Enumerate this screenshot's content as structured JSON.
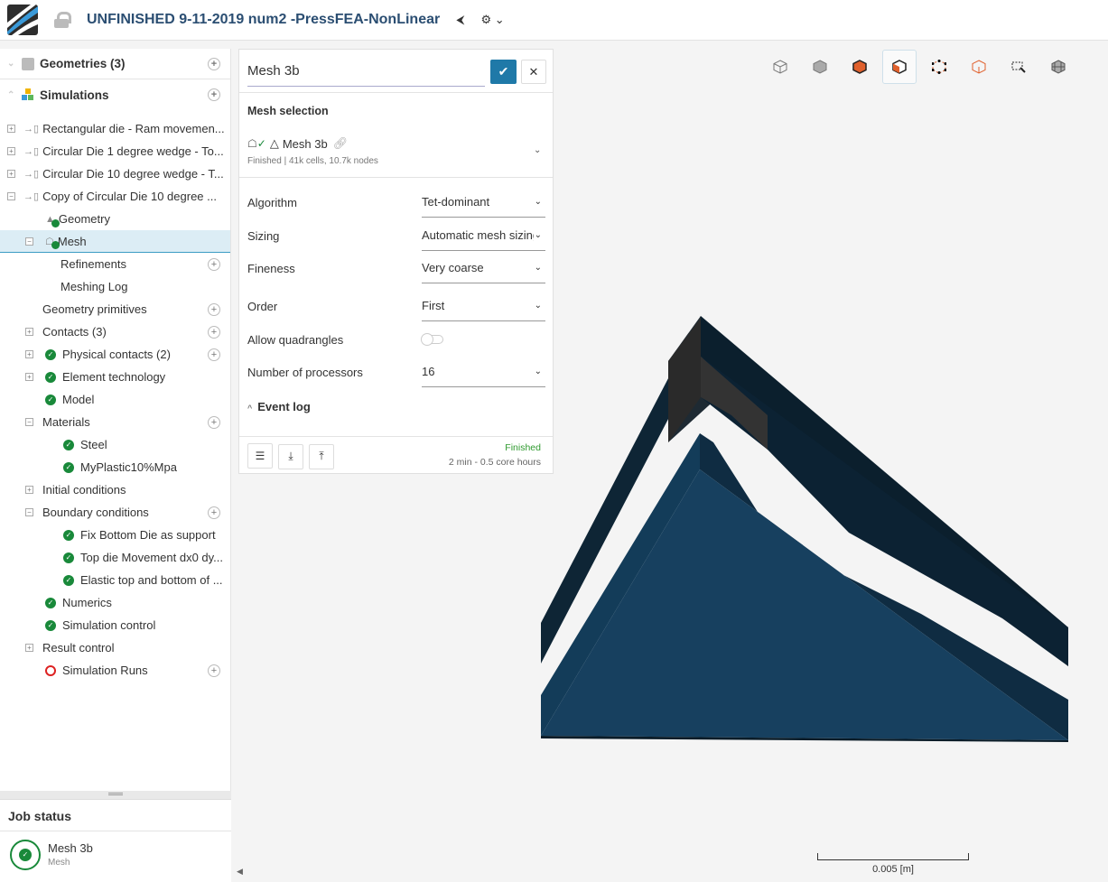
{
  "header": {
    "title": "UNFINISHED 9-11-2019 num2 -PressFEA-NonLinear",
    "share_icon": "share-icon",
    "settings_icon": "gear-icon"
  },
  "sidebar": {
    "geometries": "Geometries (3)",
    "simulations": "Simulations",
    "items": [
      {
        "label": "Rectangular die - Ram movemen...",
        "level": 0,
        "exp": "+",
        "icon": "sim",
        "plus": false
      },
      {
        "label": "Circular Die 1 degree wedge - To...",
        "level": 0,
        "exp": "+",
        "icon": "sim",
        "plus": false
      },
      {
        "label": "Circular Die 10 degree wedge - T...",
        "level": 0,
        "exp": "+",
        "icon": "sim",
        "plus": false
      },
      {
        "label": "Copy of Circular Die 10 degree ...",
        "level": 0,
        "exp": "-",
        "icon": "sim",
        "plus": false
      },
      {
        "label": "Geometry",
        "level": 1,
        "exp": "",
        "icon": "geo",
        "plus": false
      },
      {
        "label": "Mesh",
        "level": 1,
        "exp": "-",
        "icon": "mesh",
        "plus": false,
        "selected": true
      },
      {
        "label": "Refinements",
        "level": 2,
        "exp": "",
        "icon": "",
        "plus": true
      },
      {
        "label": "Meshing Log",
        "level": 2,
        "exp": "",
        "icon": "",
        "plus": false
      },
      {
        "label": "Geometry primitives",
        "level": 1,
        "exp": "",
        "icon": "",
        "plus": true,
        "tight": true
      },
      {
        "label": "Contacts (3)",
        "level": 1,
        "exp": "+",
        "icon": "",
        "plus": true,
        "tight": true
      },
      {
        "label": "Physical contacts (2)",
        "level": 1,
        "exp": "+",
        "icon": "check",
        "plus": true
      },
      {
        "label": "Element technology",
        "level": 1,
        "exp": "+",
        "icon": "check",
        "plus": false
      },
      {
        "label": "Model",
        "level": 1,
        "exp": "",
        "icon": "check",
        "plus": false
      },
      {
        "label": "Materials",
        "level": 1,
        "exp": "-",
        "icon": "",
        "plus": true,
        "tight": true
      },
      {
        "label": "Steel",
        "level": 2,
        "exp": "",
        "icon": "check",
        "plus": false
      },
      {
        "label": "MyPlastic10%Mpa",
        "level": 2,
        "exp": "",
        "icon": "check",
        "plus": false
      },
      {
        "label": "Initial conditions",
        "level": 1,
        "exp": "+",
        "icon": "",
        "plus": false,
        "tight": true
      },
      {
        "label": "Boundary conditions",
        "level": 1,
        "exp": "-",
        "icon": "",
        "plus": true,
        "tight": true
      },
      {
        "label": "Fix Bottom Die as support",
        "level": 2,
        "exp": "",
        "icon": "check",
        "plus": false
      },
      {
        "label": "Top die Movement dx0 dy...",
        "level": 2,
        "exp": "",
        "icon": "check",
        "plus": false
      },
      {
        "label": "Elastic top and bottom of ...",
        "level": 2,
        "exp": "",
        "icon": "check",
        "plus": false
      },
      {
        "label": "Numerics",
        "level": 1,
        "exp": "",
        "icon": "check",
        "plus": false
      },
      {
        "label": "Simulation control",
        "level": 1,
        "exp": "",
        "icon": "check",
        "plus": false
      },
      {
        "label": "Result control",
        "level": 1,
        "exp": "+",
        "icon": "",
        "plus": false,
        "tight": true
      },
      {
        "label": "Simulation Runs",
        "level": 1,
        "exp": "",
        "icon": "ring",
        "plus": true
      }
    ]
  },
  "job_status": {
    "title": "Job status",
    "name": "Mesh 3b",
    "type": "Mesh"
  },
  "panel": {
    "name": "Mesh 3b",
    "mesh_selection_title": "Mesh selection",
    "mesh_name": "Mesh 3b",
    "mesh_info": "Finished | 41k cells, 10.7k nodes",
    "fields": [
      {
        "label": "Algorithm",
        "value": "Tet-dominant"
      },
      {
        "label": "Sizing",
        "value": "Automatic mesh sizing"
      },
      {
        "label": "Fineness",
        "value": "Very coarse"
      },
      {
        "label": "Order",
        "value": "First"
      }
    ],
    "allow_quadrangles": {
      "label": "Allow quadrangles",
      "on": false
    },
    "processors": {
      "label": "Number of processors",
      "value": "16"
    },
    "event_log": "Event log",
    "status": "Finished",
    "duration": "2 min - 0.5 core hours",
    "status_color": "#2f9a2f"
  },
  "viewer": {
    "scale_label": "0.005 [m]",
    "mesh_color": "#12344d"
  },
  "colors": {
    "accent": "#1f79a8",
    "title": "#2b4e72",
    "check": "#19893a"
  }
}
